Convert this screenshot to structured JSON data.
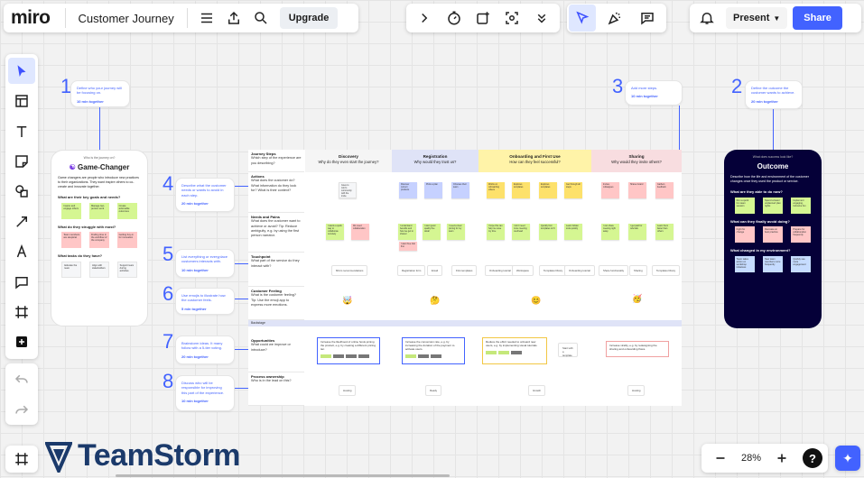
{
  "app": {
    "logo": "miro",
    "board_title": "Customer Journey",
    "upgrade_label": "Upgrade",
    "present_label": "Present",
    "share_label": "Share",
    "zoom_level": "28%",
    "help_label": "?",
    "brand_watermark": "TeamStorm"
  },
  "colors": {
    "accent": "#4262ff",
    "navy": "#050038",
    "stage_discovery": "#f5f5f5",
    "stage_registration": "#dfe3f7",
    "stage_onboarding": "#fff3a8",
    "stage_sharing": "#f8dde0"
  },
  "steps": [
    {
      "num": "1",
      "text": "Define who your journey will be focusing on.",
      "mins": "10 min together"
    },
    {
      "num": "2",
      "text": "Define the outcome the customer wants to achieve.",
      "mins": "20 min together"
    },
    {
      "num": "3",
      "text": "Add more steps.",
      "mins": "10 min together"
    },
    {
      "num": "4",
      "text": "Describe what the customer needs or wants to avoid in each step.",
      "mins": "20 min together"
    },
    {
      "num": "5",
      "text": "List everything or everyplace customers interacts with.",
      "mins": "10 min together"
    },
    {
      "num": "6",
      "text": "Use emojis to illustrate how the customer feels.",
      "mins": "5 min together"
    },
    {
      "num": "7",
      "text": "Brainstorm ideas. It many follow with a 5-tier voting.",
      "mins": "20 min together"
    },
    {
      "num": "8",
      "text": "Discuss who will be responsible for improving this part of the experience.",
      "mins": "10 min together"
    }
  ],
  "persona": {
    "kicker": "Who is the journey on?",
    "title": "Game-Changer",
    "desc": "Game changers are people who introduce new practices to their organizations. They want inspire others to co-create and innovate together.",
    "sections": [
      {
        "heading": "What are their key goals and needs?",
        "items": [
          "Inspire and engage others",
          "Manage two-person work",
          "Create actionable outcomes"
        ]
      },
      {
        "heading": "What do they struggle with most?",
        "items": [
          "Team members are skeptical",
          "Finding time in the workflow of the company",
          "Getting buy-in for innovation"
        ]
      },
      {
        "heading": "What tasks do they have?",
        "items": [
          "Educate the team",
          "Align with stakeholders",
          "Support team during activities"
        ]
      }
    ]
  },
  "outcome": {
    "kicker": "What does success look like?",
    "title": "Outcome",
    "desc": "Describe how the life and environment of the customer changes once they used the product or service.",
    "sections": [
      {
        "heading": "What are they able to do now?",
        "items": [
          "Run a quick fun team session",
          "Spend a fewer unplanned plan rights",
          "Implement engaging, inclusive fun"
        ]
      },
      {
        "heading": "What can they finally avoid doing?",
        "items": [
          "Fight for change",
          "Recreate on best practice",
          "Prepare for collaboration frequently"
        ]
      },
      {
        "heading": "What changed in my environment?",
        "items": [
          "Team takes action on workshop initiatives",
          "New team members more frequently",
          "Quickly see more engagement"
        ]
      }
    ]
  },
  "journey": {
    "row_heads": [
      {
        "title": "Journey Steps",
        "text": "Which step of the experience are you describing?"
      },
      {
        "title": "Actions",
        "text": "What does the customer do? What information do they look for? What is their context?"
      },
      {
        "title": "Needs and Pains",
        "text": "What does the customer want to achieve or avoid? Tip: Reduce ambiguity, e.g. by using the first person narrator."
      },
      {
        "title": "Touchpoint",
        "text": "What part of the service do they interact with?"
      },
      {
        "title": "Customer Feeling",
        "text": "What is the customer feeling? Tip: Use the emoji app to express more emotions."
      },
      {
        "title": "Opportunities",
        "text": "What could we improve or introduce?"
      },
      {
        "title": "Process ownership",
        "text": "Who is in the lead on this?"
      }
    ],
    "stages": [
      {
        "title": "Discovery",
        "question": "Why do they even start the journey?"
      },
      {
        "title": "Registration",
        "question": "Why would they trust us?"
      },
      {
        "title": "Onboarding and First Use",
        "question": "How can they feel successful?"
      },
      {
        "title": "Sharing",
        "question": "Why would they invite others?"
      }
    ],
    "backstage_label": "Backstage",
    "actions": [
      [
        "Goes to miro's community with the invite"
      ],
      [
        "Discover current products",
        "Picks a plan",
        "Chooses their team"
      ],
      [
        "Works on onboarding videos",
        "Explores templates",
        "Explores templates",
        "Get through all steps"
      ],
      [
        "Invites colleagues",
        "Shares board",
        "Gathers feedback"
      ]
    ],
    "needs": [
      [
        "I wants a quick way to collaborate remotely",
        "We need collaboration"
      ],
      [
        "I understand benefits and how we get to shared",
        "I want good quality fine detail",
        "I need a clear pricing for my team",
        "I want free trial first"
      ],
      [
        "I hope this can help me save my time",
        "I don't need more meeting overhead",
        "Quickly find templates to fit",
        "Learn hidden tools quickly"
      ],
      [
        "I can share meeting right away",
        "I get paid for referrals",
        "Learn them faster than others"
      ]
    ],
    "touchpoints": [
      [
        "Miro's recommendations"
      ],
      [
        "Registration form",
        "Email",
        "First templates"
      ],
      [
        "Onboarding tutorial",
        "Workspace",
        "Templates library",
        "Onboarding tutorial"
      ],
      [
        "Share functionality",
        "Sharing",
        "Templates library"
      ]
    ],
    "feelings": [
      "🤯",
      "🤔",
      "😊",
      "🥳"
    ],
    "opportunities": [
      "Increase the likelihood of online hosts joining the product, e.g. by creating a different pricing tier.",
      "Increase the conversion rate, e.g. by increasing the duration of the payment to activate users.",
      "Reduce the effort needed to onboard new users, e.g. by implementing visual tutorials.",
      "Increase virality, e.g. by redesigning the sharing and onboarding flows."
    ],
    "extra_note": "Start with a template",
    "owners": [
      "Hosting",
      "Ready",
      "Growth",
      "Hosting"
    ]
  }
}
